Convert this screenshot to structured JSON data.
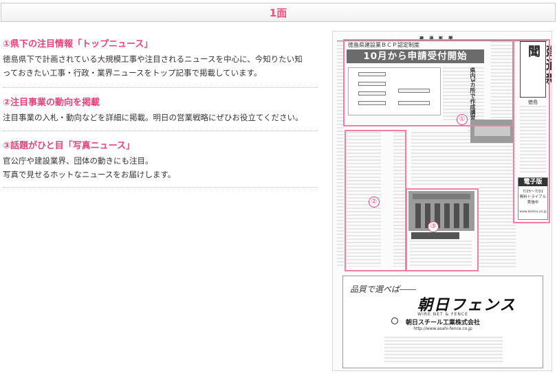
{
  "page": {
    "title": "1面"
  },
  "sections": [
    {
      "title": "①県下の注目情報「トップニュース」",
      "lines": [
        "徳島県下で計画されている大規模工事や注目されるニュースを中心に、今知りたい知",
        "っておきたい工事・行政・業界ニュースをトップ記事で掲載しています。"
      ]
    },
    {
      "title": "②注目事業の動向を掲載",
      "lines": [
        "注目事業の入札・動向などを詳細に掲載。明日の営業戦略にぜひお役立てください。"
      ]
    },
    {
      "title": "③話題がひと目「写真ニュース」",
      "lines": [
        "官公庁や建設業界、団体の動きにも注目。",
        "写真で見せるホットなニュースをお届けします。"
      ]
    }
  ],
  "newspaper": {
    "masthead": "建 通 新 聞",
    "brand": "建通新聞",
    "region": "徳島",
    "kicker": "徳島県建設業ＢＣＰ認定制度",
    "headline": "10月から申請受付開始",
    "subhead": "県内3カ所で作成講習会",
    "callouts": [
      "①",
      "②",
      "③"
    ],
    "ebook": {
      "title": "電子版",
      "dates": "7/25～7/31",
      "trial": "無料トライアル",
      "status": "実施中",
      "url": "www.kentsu.co.jp"
    },
    "ad": {
      "catch": "品質で選べば――",
      "brand": "朝日フェンス",
      "tagline": "WIRE NET & FENCE",
      "company": "朝日スチール工業株式会社",
      "url": "http://www.asahi-fence.co.jp"
    }
  }
}
